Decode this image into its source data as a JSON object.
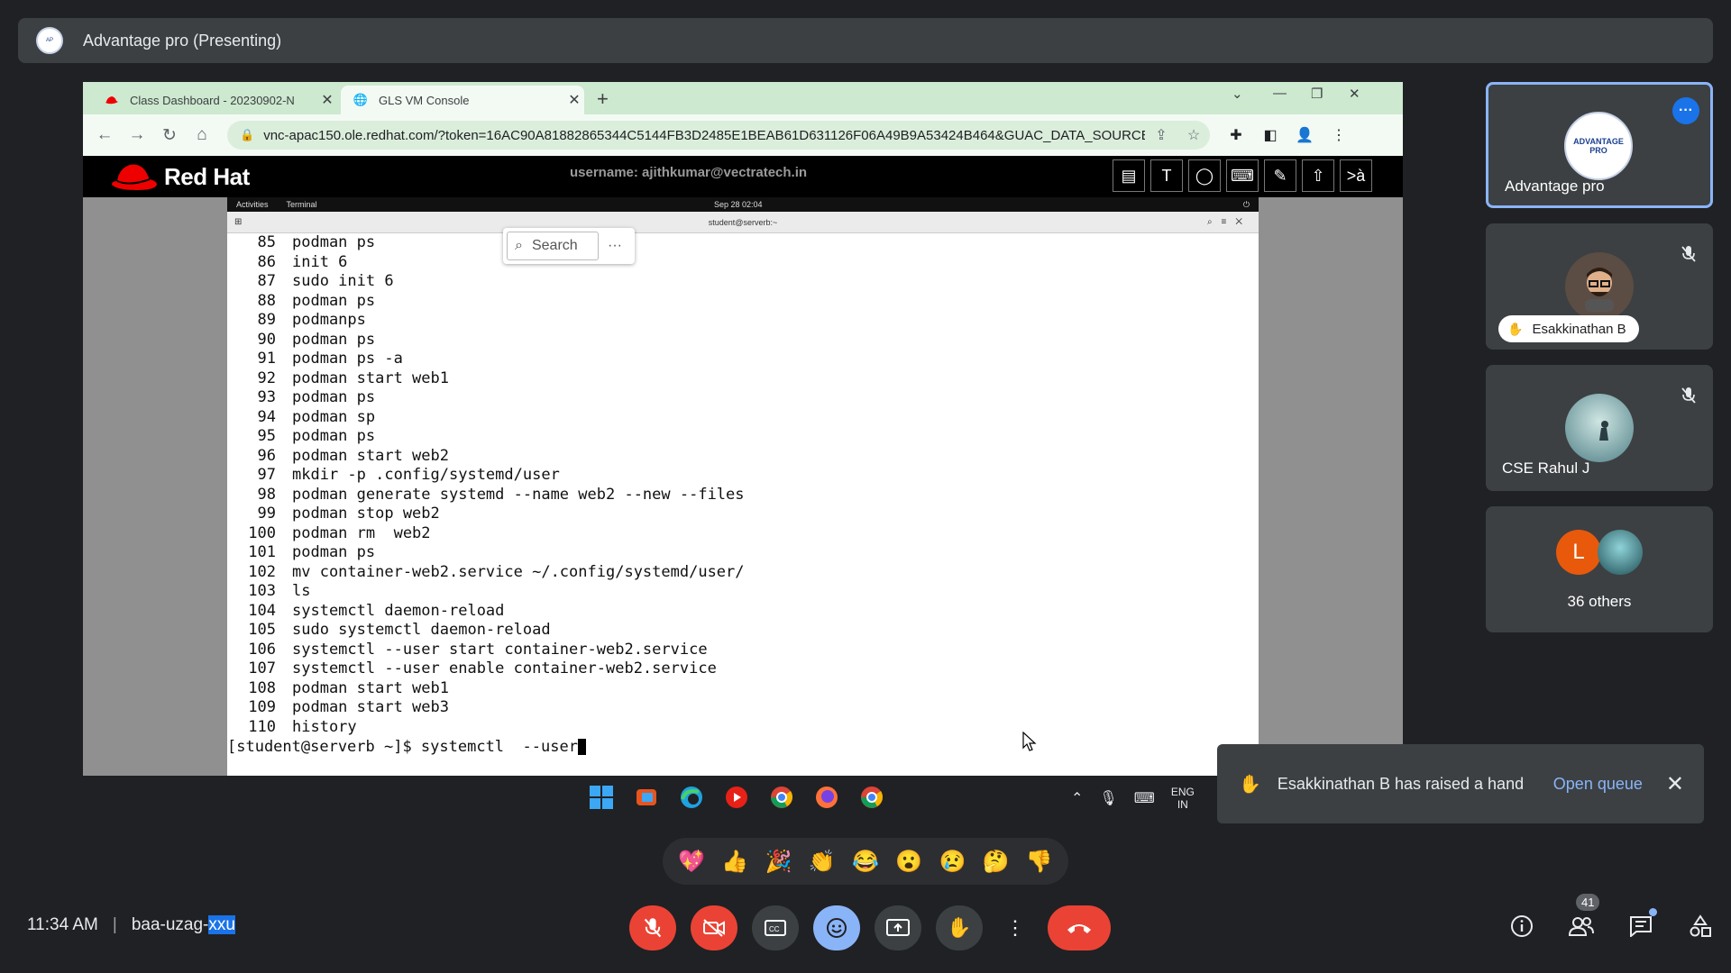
{
  "header": {
    "title": "Advantage pro (Presenting)"
  },
  "browser": {
    "tabs": [
      {
        "label": "Class Dashboard - 20230902-N",
        "icon": "redhat-icon"
      },
      {
        "label": "GLS VM Console",
        "icon": "globe-icon"
      }
    ],
    "url": "vnc-apac150.ole.redhat.com/?token=16AC90A81882865344C5144FB3D2485E1BEAB61D631126F06A49B9A53424B464&GUAC_DATA_SOURCE=j..."
  },
  "console": {
    "brand": "Red Hat",
    "username": "username: ajithkumar@vectratech.in",
    "tool_labels": [
      "T",
      ">à"
    ]
  },
  "gnome": {
    "activities": "Activities",
    "terminal": "Terminal",
    "clock": "Sep 28  02:04"
  },
  "terminal": {
    "title": "student@serverb:~",
    "search_placeholder": "Search",
    "history": [
      {
        "n": "85",
        "cmd": "podman ps"
      },
      {
        "n": "86",
        "cmd": "init 6"
      },
      {
        "n": "87",
        "cmd": "sudo init 6"
      },
      {
        "n": "88",
        "cmd": "podman ps"
      },
      {
        "n": "89",
        "cmd": "podmanps"
      },
      {
        "n": "90",
        "cmd": "podman ps"
      },
      {
        "n": "91",
        "cmd": "podman ps -a"
      },
      {
        "n": "92",
        "cmd": "podman start web1"
      },
      {
        "n": "93",
        "cmd": "podman ps"
      },
      {
        "n": "94",
        "cmd": "podman sp"
      },
      {
        "n": "95",
        "cmd": "podman ps"
      },
      {
        "n": "96",
        "cmd": "podman start web2"
      },
      {
        "n": "97",
        "cmd": "mkdir -p .config/systemd/user"
      },
      {
        "n": "98",
        "cmd": "podman generate systemd --name web2 --new --files"
      },
      {
        "n": "99",
        "cmd": "podman stop web2"
      },
      {
        "n": "100",
        "cmd": "podman rm  web2"
      },
      {
        "n": "101",
        "cmd": "podman ps"
      },
      {
        "n": "102",
        "cmd": "mv container-web2.service ~/.config/systemd/user/"
      },
      {
        "n": "103",
        "cmd": "ls"
      },
      {
        "n": "104",
        "cmd": "systemctl daemon-reload"
      },
      {
        "n": "105",
        "cmd": "sudo systemctl daemon-reload"
      },
      {
        "n": "106",
        "cmd": "systemctl --user start container-web2.service"
      },
      {
        "n": "107",
        "cmd": "systemctl --user enable container-web2.service"
      },
      {
        "n": "108",
        "cmd": "podman start web1"
      },
      {
        "n": "109",
        "cmd": "podman start web3"
      },
      {
        "n": "110",
        "cmd": "history"
      }
    ],
    "prompt": "[student@serverb ~]$ systemctl  --user"
  },
  "tray": {
    "lang_line1": "ENG",
    "lang_line2": "IN"
  },
  "reactions": [
    "💖",
    "👍",
    "🎉",
    "👏",
    "😂",
    "😮",
    "😢",
    "🤔",
    "👎"
  ],
  "participants": {
    "pinned": {
      "name": "Advantage pro",
      "logo_text": "ADVANTAGE PRO"
    },
    "p2": {
      "name": "Esakkinathan B"
    },
    "p3": {
      "name": "CSE Rahul J"
    },
    "others": {
      "label": "36 others",
      "initial": "L",
      "initial_color": "#e8590c"
    }
  },
  "toast": {
    "message": "Esakkinathan B has raised a hand",
    "action": "Open queue"
  },
  "bottom": {
    "time": "11:34 AM",
    "meeting_code_a": "baa-uzag-",
    "meeting_code_b": "xxu",
    "participants_count": "41"
  },
  "colors": {
    "accent": "#8ab4f8",
    "danger": "#ea4335",
    "redhat": "#ee0000"
  }
}
